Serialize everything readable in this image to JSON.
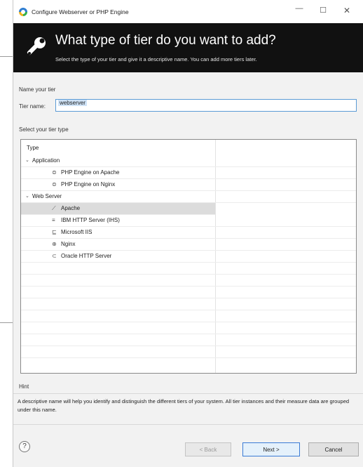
{
  "window": {
    "title": "Configure Webserver or PHP Engine",
    "minimize": "—",
    "maximize": "☐",
    "close": "✕"
  },
  "banner": {
    "title": "What type of tier do you want to add?",
    "subtitle": "Select the type of your tier and give it a descriptive name. You can add more tiers later.",
    "icon": "wrench-icon"
  },
  "name_section": {
    "label": "Name your tier",
    "field_label": "Tier name:",
    "field_value": "webserver"
  },
  "type_section": {
    "label": "Select your tier type",
    "column_header": "Type",
    "groups": [
      {
        "label": "Application",
        "twisty": "⌄",
        "items": [
          {
            "label": "PHP Engine on Apache",
            "icon": "php-icon"
          },
          {
            "label": "PHP Engine on Nginx",
            "icon": "php-icon"
          }
        ]
      },
      {
        "label": "Web Server",
        "twisty": "⌄",
        "items": [
          {
            "label": "Apache",
            "icon": "feather-icon",
            "selected": true
          },
          {
            "label": "IBM HTTP Server (IHS)",
            "icon": "ibm-icon"
          },
          {
            "label": "Microsoft IIS",
            "icon": "iis-icon"
          },
          {
            "label": "Nginx",
            "icon": "nginx-icon"
          },
          {
            "label": "Oracle HTTP Server",
            "icon": "oracle-icon"
          }
        ]
      }
    ]
  },
  "hint": {
    "label": "Hint",
    "text": "A descriptive name will help you identify and distinguish the different tiers of your system. All tier instances and their measure data are grouped under this name."
  },
  "footer": {
    "help": "?",
    "back": "< Back",
    "next": "Next >",
    "cancel": "Cancel"
  }
}
